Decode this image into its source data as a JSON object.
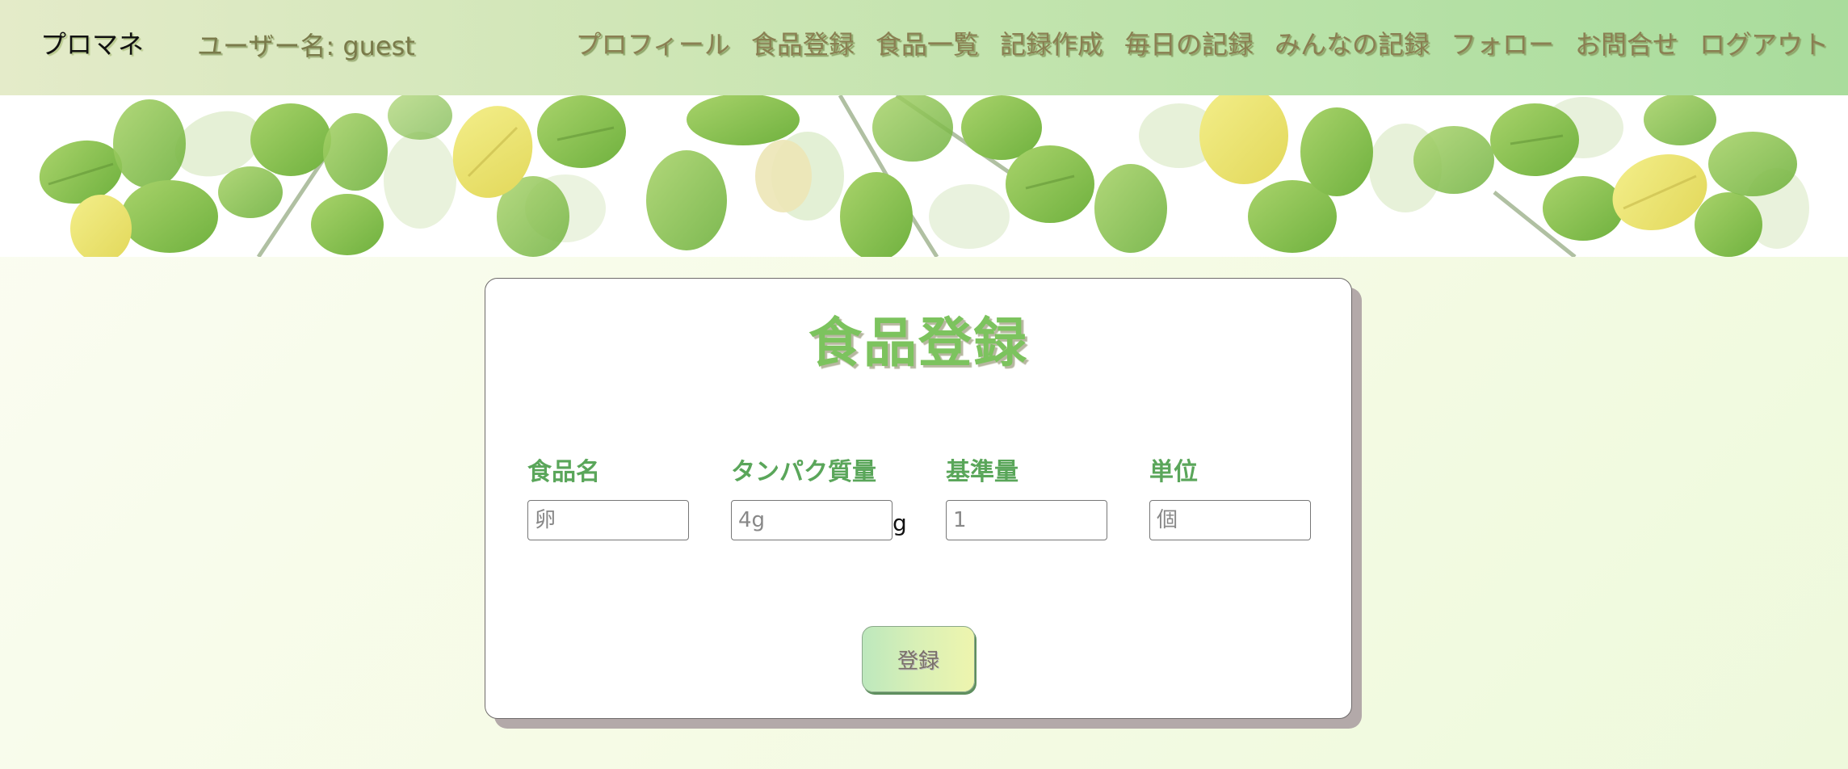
{
  "header": {
    "brand": "プロマネ",
    "username": "ユーザー名: guest",
    "nav": [
      {
        "label": "プロフィール"
      },
      {
        "label": "食品登録"
      },
      {
        "label": "食品一覧"
      },
      {
        "label": "記録作成"
      },
      {
        "label": "毎日の記録"
      },
      {
        "label": "みんなの記録"
      },
      {
        "label": "フォロー"
      },
      {
        "label": "お問合せ"
      },
      {
        "label": "ログアウト"
      }
    ]
  },
  "form": {
    "title": "食品登録",
    "fields": [
      {
        "label": "食品名",
        "placeholder": "卵",
        "value": ""
      },
      {
        "label": "タンパク質量",
        "placeholder": "4g",
        "value": "",
        "suffix": "g"
      },
      {
        "label": "基準量",
        "placeholder": "1",
        "value": ""
      },
      {
        "label": "単位",
        "placeholder": "個",
        "value": ""
      }
    ],
    "submit_label": "登録"
  },
  "colors": {
    "accent_green": "#7cc35e",
    "label_green": "#5aa65a",
    "nav_text": "#8a7f52"
  }
}
